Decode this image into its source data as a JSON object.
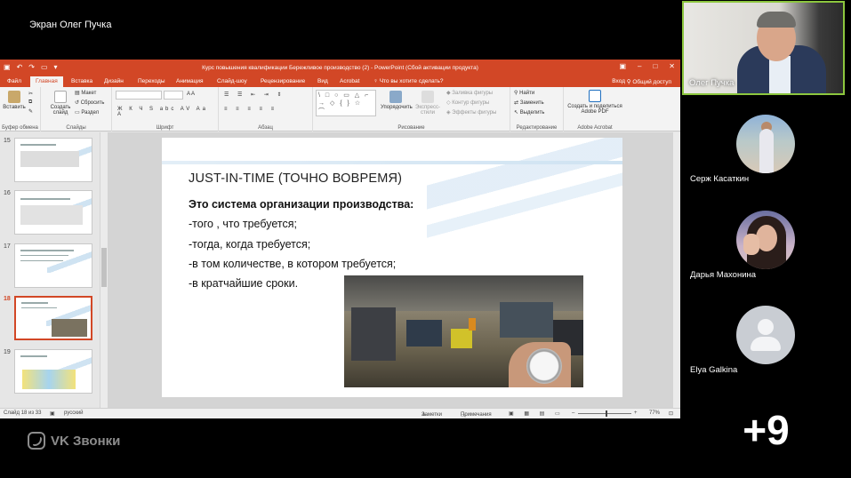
{
  "share": {
    "title": "Экран Олег Пучка"
  },
  "ppt": {
    "window_title": "Курс повышения квалификации Бережливое производство (2) - PowerPoint (Сбой активации продукта)",
    "tabs": [
      "Файл",
      "Главная",
      "Вставка",
      "Дизайн",
      "Переходы",
      "Анимация",
      "Слайд-шоу",
      "Рецензирование",
      "Вид",
      "Acrobat"
    ],
    "tell_me": "Что вы хотите сделать?",
    "login": "Вход",
    "share": "Общий доступ",
    "ribbon": {
      "paste": "Вставить",
      "create_slide": "Создать слайд",
      "layout": "Макет",
      "reset": "Сбросить",
      "section": "Раздел",
      "arrange": "Упорядочить",
      "express_styles": "Экспресс-стили",
      "shape_fill": "Заливка фигуры",
      "shape_outline": "Контур фигуры",
      "shape_effects": "Эффекты фигуры",
      "find": "Найти",
      "replace": "Заменить",
      "select": "Выделить",
      "create_pdf": "Создать и поделиться Adobe PDF",
      "groups": {
        "clipboard": "Буфер обмена",
        "slides": "Слайды",
        "font": "Шрифт",
        "paragraph": "Абзац",
        "drawing": "Рисование",
        "editing": "Редактирование",
        "acrobat": "Adobe Acrobat"
      },
      "font_buttons": "Ж К Ч S abc AV Aa A",
      "para_buttons": "≡ ≡ ≡ ≡ ≡"
    },
    "thumbnails": [
      {
        "num": "15",
        "active": false
      },
      {
        "num": "16",
        "active": false
      },
      {
        "num": "17",
        "active": false
      },
      {
        "num": "18",
        "active": true
      },
      {
        "num": "19",
        "active": false
      }
    ],
    "slide": {
      "title": "JUST-IN-TIME (ТОЧНО ВОВРЕМЯ)",
      "lines": [
        "Это система организации производства:",
        "-того , что требуется;",
        "-тогда, когда требуется;",
        "-в том количестве, в котором требуется;",
        "-в кратчайшие сроки."
      ]
    },
    "status": {
      "slide_pos": "Слайд 18 из 33",
      "language": "русский",
      "notes": "Заметки",
      "comments": "Примечания",
      "zoom": "77%"
    }
  },
  "participants": {
    "speaker": "Олег Пучка",
    "list": [
      "Серж Касаткин",
      "Дарья Махонина",
      "Elya Galkina"
    ],
    "more": "+9"
  },
  "brand": {
    "name": "VK Звонки"
  },
  "colors": {
    "ppt_accent": "#d24726",
    "speaking_border": "#8cc63e"
  }
}
